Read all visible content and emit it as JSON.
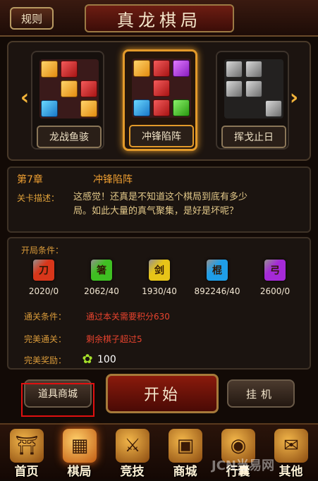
{
  "header": {
    "rules_label": "规则",
    "title": "真龙棋局"
  },
  "stages": [
    {
      "label": "龙战鱼骇",
      "selected": false,
      "cells": [
        "orange",
        "red",
        "empty",
        "empty",
        "orange",
        "red",
        "blue",
        "empty",
        "orange"
      ]
    },
    {
      "label": "冲锋陷阵",
      "selected": true,
      "cells": [
        "orange",
        "red",
        "purple",
        "empty",
        "red",
        "empty",
        "blue",
        "red",
        "green"
      ]
    },
    {
      "label": "挥戈止日",
      "selected": false,
      "cells": [
        "gray",
        "gray",
        "empty",
        "gray",
        "gray",
        "empty",
        "empty",
        "empty",
        "gray"
      ]
    }
  ],
  "icons": {
    "left_arrow": "chevron-left-icon",
    "right_arrow": "chevron-right-icon"
  },
  "info": {
    "chapter": "第7章",
    "stage_name": "冲锋陷阵",
    "desc_label": "关卡描述：",
    "desc_line1": "这感觉！还真是不知道这个棋局到底有多少",
    "desc_line2": "局。如此大量的真气聚集，是好是坏呢？"
  },
  "conditions": {
    "open_label": "开局条件：",
    "gems": [
      {
        "char": "刀",
        "value": "2020/0",
        "color": "#d8361a"
      },
      {
        "char": "箸",
        "value": "2062/40",
        "color": "#3fbf22"
      },
      {
        "char": "剑",
        "value": "1930/40",
        "color": "#e7c418"
      },
      {
        "char": "棍",
        "value": "892246/40",
        "color": "#1f9ee8"
      },
      {
        "char": "弓",
        "value": "2600/0",
        "color": "#a52ad8"
      }
    ],
    "clear_label": "通关条件：",
    "clear_text": "通过本关需要积分630",
    "perfect_label": "完美通关：",
    "perfect_text": "剩余棋子超过5",
    "reward_label": "完美奖励：",
    "reward_value": "100"
  },
  "buttons": {
    "shop": "道具商城",
    "start": "开始",
    "idle": "挂机"
  },
  "nav": [
    {
      "label": "首页",
      "icon": "palace-icon",
      "glyph": "⛩"
    },
    {
      "label": "棋局",
      "icon": "chessboard-icon",
      "glyph": "▦"
    },
    {
      "label": "竞技",
      "icon": "crossed-swords-icon",
      "glyph": "⚔"
    },
    {
      "label": "商城",
      "icon": "treasure-chest-icon",
      "glyph": "▣"
    },
    {
      "label": "行囊",
      "icon": "bag-icon",
      "glyph": "◉"
    },
    {
      "label": "其他",
      "icon": "scroll-icon",
      "glyph": "✉"
    }
  ],
  "nav_active": 1,
  "watermark": "JCN当易网"
}
